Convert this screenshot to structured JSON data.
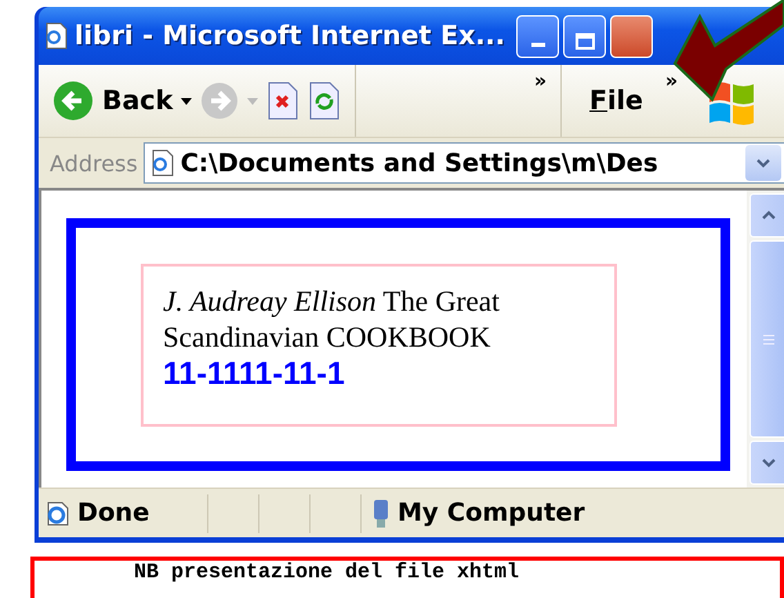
{
  "window": {
    "title": "libri - Microsoft Internet Ex..."
  },
  "toolbar": {
    "back": "Back",
    "chevrons": [
      "»",
      "»"
    ],
    "menu": "File"
  },
  "address": {
    "label": "Address",
    "value": "C:\\Documents and Settings\\m\\Des"
  },
  "page": {
    "citation": "*J. Audreay Ellison* The Great Scandinavian COOKBOOK",
    "isbn": "11-1111-11-1"
  },
  "status_bar": {
    "text": "Done",
    "zone": "My Computer"
  },
  "note": "NB presentazione del file xhtml"
}
